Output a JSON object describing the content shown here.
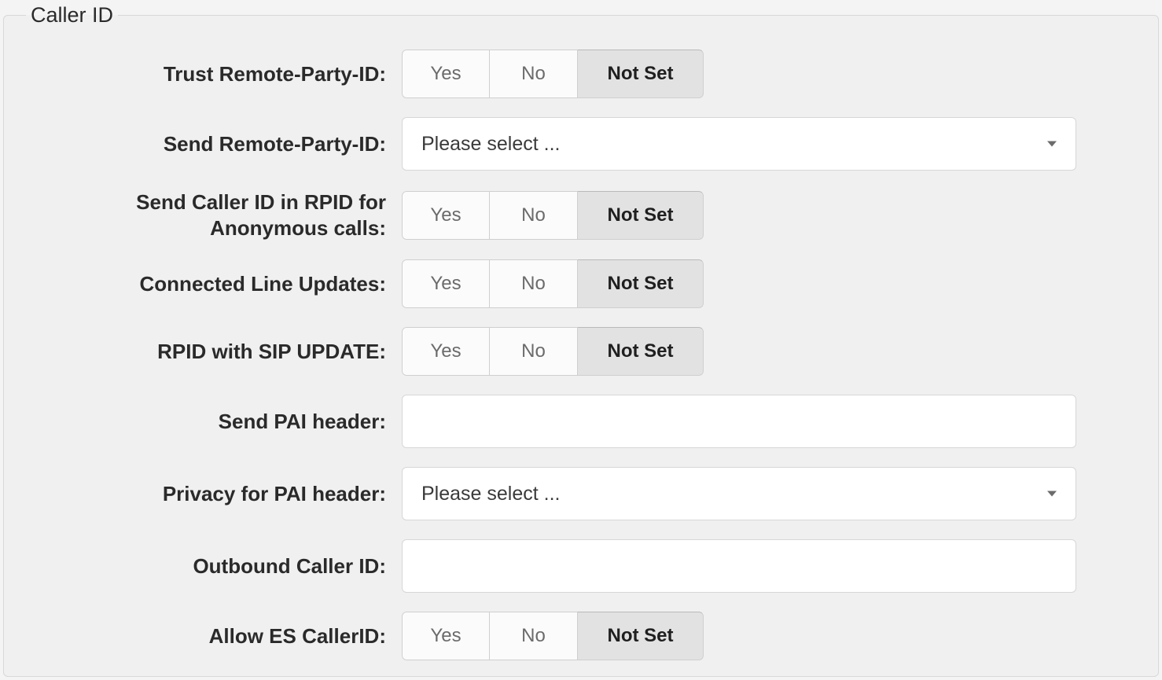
{
  "legend": "Caller ID",
  "buttons": {
    "yes": "Yes",
    "no": "No",
    "notset": "Not Set"
  },
  "select_placeholder": "Please select ...",
  "rows": {
    "trust_rpid": {
      "label": "Trust Remote-Party-ID:",
      "selected": "notset"
    },
    "send_rpid": {
      "label": "Send Remote-Party-ID:",
      "value": "Please select ..."
    },
    "send_cid_rpid_anon": {
      "label": "Send Caller ID in RPID for Anonymous calls:",
      "selected": "notset"
    },
    "connected_line_updates": {
      "label": "Connected Line Updates:",
      "selected": "notset"
    },
    "rpid_sip_update": {
      "label": "RPID with SIP UPDATE:",
      "selected": "notset"
    },
    "send_pai_header": {
      "label": "Send PAI header:",
      "value": ""
    },
    "privacy_pai_header": {
      "label": "Privacy for PAI header:",
      "value": "Please select ..."
    },
    "outbound_caller_id": {
      "label": "Outbound Caller ID:",
      "value": ""
    },
    "allow_es_callerid": {
      "label": "Allow ES CallerID:",
      "selected": "notset"
    }
  }
}
